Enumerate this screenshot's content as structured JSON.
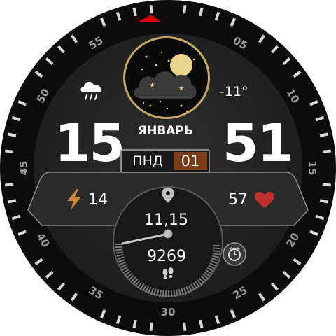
{
  "time": {
    "hours": "15",
    "minutes": "51"
  },
  "date": {
    "month": "ЯНВАРЬ",
    "weekday": "ПНД",
    "day": "01"
  },
  "weather": {
    "temperature": "-11°",
    "condition_icon": "rain-cloud-icon"
  },
  "stats": {
    "power": "14",
    "heart_rate": "57",
    "distance": "11,15",
    "steps": "9269"
  },
  "bezel": {
    "labels": [
      "05",
      "10",
      "15",
      "20",
      "25",
      "30",
      "35",
      "40",
      "45",
      "50",
      "55"
    ]
  },
  "colors": {
    "accent": "#7a3d19",
    "heart": "#c0302e",
    "bolt": "#c98a3a",
    "marker": "#e00000",
    "moon_ring": "#c9a866"
  }
}
